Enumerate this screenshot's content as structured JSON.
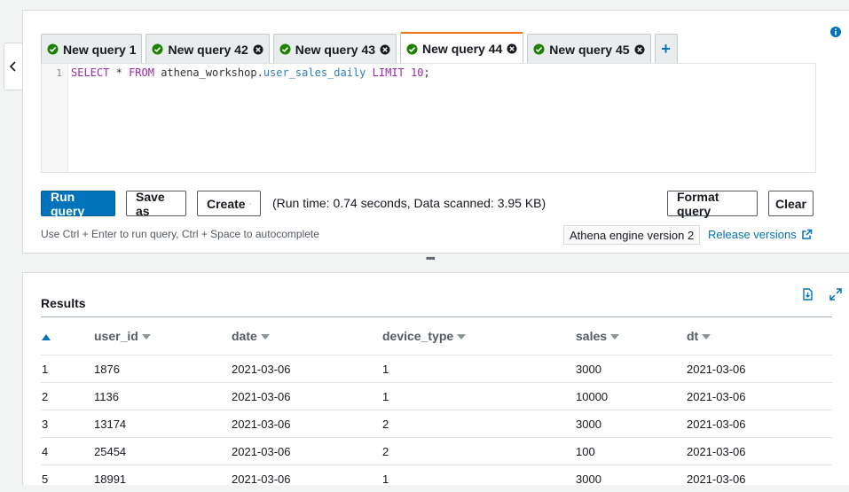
{
  "editor": {
    "tabs": [
      {
        "label": "New query 1",
        "closable": false,
        "active": false
      },
      {
        "label": "New query 42",
        "closable": true,
        "active": false
      },
      {
        "label": "New query 43",
        "closable": true,
        "active": false
      },
      {
        "label": "New query 44",
        "closable": true,
        "active": true
      },
      {
        "label": "New query 45",
        "closable": true,
        "active": false
      }
    ],
    "add_tab_label": "+",
    "line_number": "1",
    "code": {
      "kw_select": "SELECT",
      "star": "*",
      "kw_from": "FROM",
      "db": "athena_workshop",
      "dot": ".",
      "table": "user_sales_daily",
      "kw_limit": "LIMIT",
      "limit": "10",
      "semi": ";"
    },
    "buttons": {
      "run": "Run query",
      "save": "Save as",
      "create": "Create",
      "format": "Format query",
      "clear": "Clear"
    },
    "run_info": "(Run time: 0.74 seconds, Data scanned: 3.95 KB)",
    "hint": "Use Ctrl + Enter to run query, Ctrl + Space to autocomplete",
    "engine": "Athena engine version 2",
    "release_link": "Release versions"
  },
  "results": {
    "title": "Results",
    "columns": [
      "user_id",
      "date",
      "device_type",
      "sales",
      "dt"
    ],
    "rows": [
      [
        "1",
        "1876",
        "2021-03-06",
        "1",
        "3000",
        "2021-03-06"
      ],
      [
        "2",
        "1136",
        "2021-03-06",
        "1",
        "10000",
        "2021-03-06"
      ],
      [
        "3",
        "13174",
        "2021-03-06",
        "2",
        "3000",
        "2021-03-06"
      ],
      [
        "4",
        "25454",
        "2021-03-06",
        "2",
        "100",
        "2021-03-06"
      ],
      [
        "5",
        "18991",
        "2021-03-06",
        "1",
        "3000",
        "2021-03-06"
      ]
    ]
  },
  "colors": {
    "accent": "#ec7211",
    "primary": "#0073bb",
    "success": "#1d8102"
  }
}
